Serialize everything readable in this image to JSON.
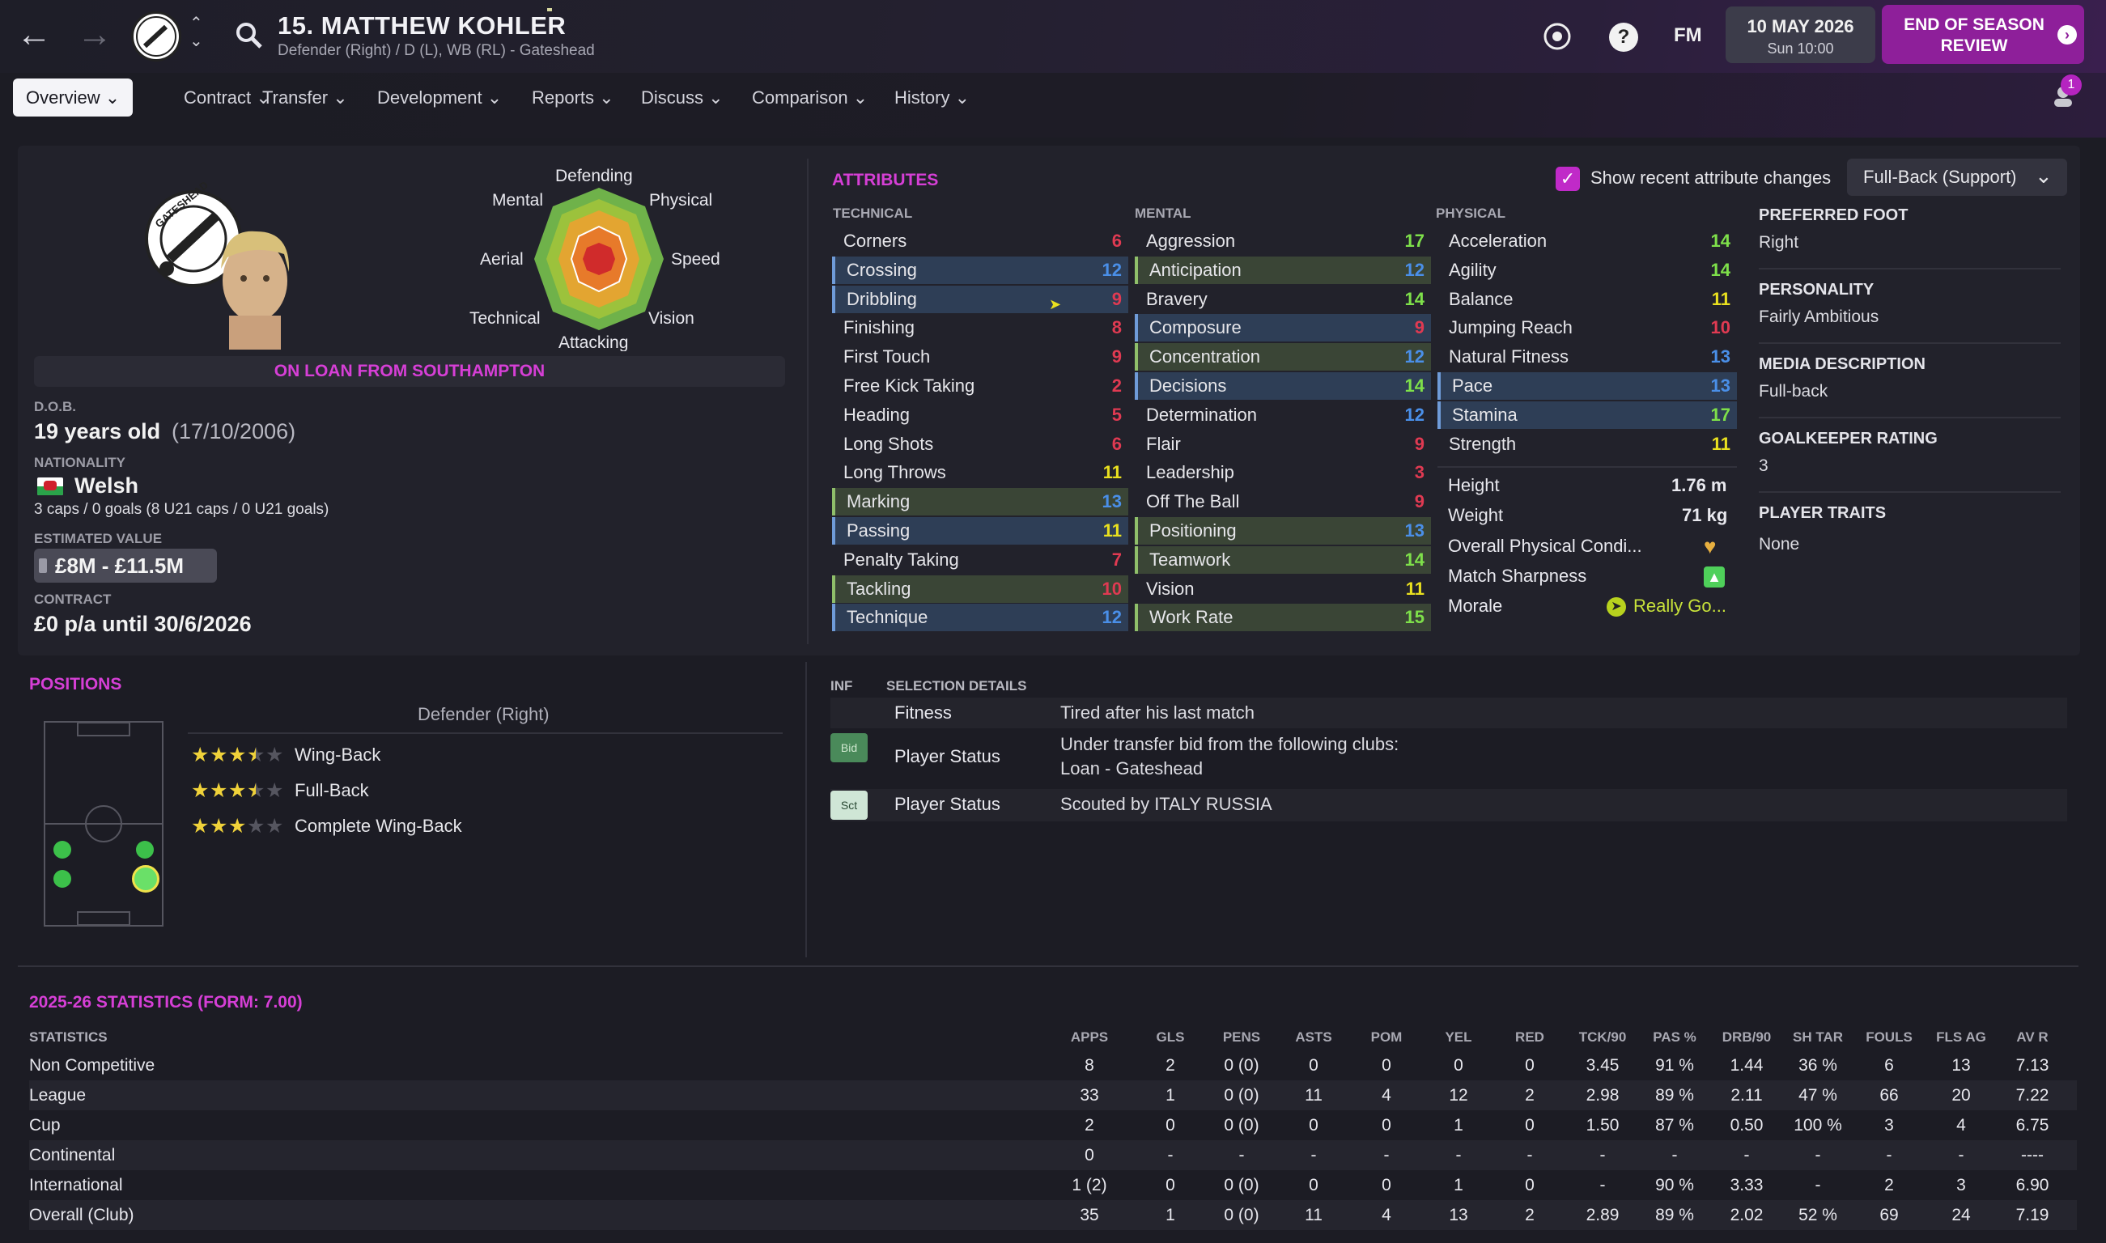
{
  "header": {
    "title": "15. MATTHEW KOHLER",
    "subtitle": "Defender (Right) / D (L), WB (RL) - Gateshead",
    "date": "10 MAY 2026",
    "time": "Sun 10:00",
    "fm_label": "FM",
    "help_label": "?",
    "eos_button": "END OF SEASON REVIEW",
    "notification_count": "1"
  },
  "tabs": [
    "Overview",
    "Contract",
    "Transfer",
    "Development",
    "Reports",
    "Discuss",
    "Comparison",
    "History"
  ],
  "profile": {
    "club_badge_text": "GATESHEAD",
    "radar_labels": {
      "defending": "Defending",
      "physical": "Physical",
      "speed": "Speed",
      "vision": "Vision",
      "attacking": "Attacking",
      "technical": "Technical",
      "aerial": "Aerial",
      "mental": "Mental"
    },
    "loan_banner": "ON LOAN FROM SOUTHAMPTON",
    "dob_label": "D.O.B.",
    "age": "19 years old",
    "dob": "(17/10/2006)",
    "nationality_label": "NATIONALITY",
    "nationality": "Welsh",
    "caps": "3 caps / 0 goals (8 U21 caps / 0 U21 goals)",
    "value_label": "ESTIMATED VALUE",
    "value": "£8M - £11.5M",
    "contract_label": "CONTRACT",
    "contract": "£0 p/a until 30/6/2026"
  },
  "attributes": {
    "title": "ATTRIBUTES",
    "show_changes_label": "Show recent attribute changes",
    "role_select": "Full-Back (Support)",
    "technical_label": "TECHNICAL",
    "mental_label": "MENTAL",
    "physical_label": "PHYSICAL",
    "technical": [
      {
        "name": "Corners",
        "value": "6",
        "hl": "",
        "color": "red"
      },
      {
        "name": "Crossing",
        "value": "12",
        "hl": "blue",
        "color": "blue"
      },
      {
        "name": "Dribbling",
        "value": "9",
        "hl": "blue",
        "color": "red"
      },
      {
        "name": "Finishing",
        "value": "8",
        "hl": "",
        "color": "red"
      },
      {
        "name": "First Touch",
        "value": "9",
        "hl": "",
        "color": "red"
      },
      {
        "name": "Free Kick Taking",
        "value": "2",
        "hl": "",
        "color": "red"
      },
      {
        "name": "Heading",
        "value": "5",
        "hl": "",
        "color": "red"
      },
      {
        "name": "Long Shots",
        "value": "6",
        "hl": "",
        "color": "red"
      },
      {
        "name": "Long Throws",
        "value": "11",
        "hl": "",
        "color": "yellow"
      },
      {
        "name": "Marking",
        "value": "13",
        "hl": "green",
        "color": "blue"
      },
      {
        "name": "Passing",
        "value": "11",
        "hl": "blue",
        "color": "yellow"
      },
      {
        "name": "Penalty Taking",
        "value": "7",
        "hl": "",
        "color": "red"
      },
      {
        "name": "Tackling",
        "value": "10",
        "hl": "green",
        "color": "red"
      },
      {
        "name": "Technique",
        "value": "12",
        "hl": "blue",
        "color": "blue"
      }
    ],
    "mental": [
      {
        "name": "Aggression",
        "value": "17",
        "hl": "",
        "color": "green"
      },
      {
        "name": "Anticipation",
        "value": "12",
        "hl": "green",
        "color": "blue"
      },
      {
        "name": "Bravery",
        "value": "14",
        "hl": "",
        "color": "green"
      },
      {
        "name": "Composure",
        "value": "9",
        "hl": "blue",
        "color": "red"
      },
      {
        "name": "Concentration",
        "value": "12",
        "hl": "green",
        "color": "blue"
      },
      {
        "name": "Decisions",
        "value": "14",
        "hl": "blue",
        "color": "green"
      },
      {
        "name": "Determination",
        "value": "12",
        "hl": "",
        "color": "blue"
      },
      {
        "name": "Flair",
        "value": "9",
        "hl": "",
        "color": "red"
      },
      {
        "name": "Leadership",
        "value": "3",
        "hl": "",
        "color": "red"
      },
      {
        "name": "Off The Ball",
        "value": "9",
        "hl": "",
        "color": "red"
      },
      {
        "name": "Positioning",
        "value": "13",
        "hl": "green",
        "color": "blue"
      },
      {
        "name": "Teamwork",
        "value": "14",
        "hl": "green",
        "color": "green"
      },
      {
        "name": "Vision",
        "value": "11",
        "hl": "",
        "color": "yellow"
      },
      {
        "name": "Work Rate",
        "value": "15",
        "hl": "green",
        "color": "green"
      }
    ],
    "physical": [
      {
        "name": "Acceleration",
        "value": "14",
        "hl": "",
        "color": "green"
      },
      {
        "name": "Agility",
        "value": "14",
        "hl": "",
        "color": "green"
      },
      {
        "name": "Balance",
        "value": "11",
        "hl": "",
        "color": "yellow"
      },
      {
        "name": "Jumping Reach",
        "value": "10",
        "hl": "",
        "color": "red"
      },
      {
        "name": "Natural Fitness",
        "value": "13",
        "hl": "",
        "color": "blue"
      },
      {
        "name": "Pace",
        "value": "13",
        "hl": "blue",
        "color": "blue"
      },
      {
        "name": "Stamina",
        "value": "17",
        "hl": "blue",
        "color": "green"
      },
      {
        "name": "Strength",
        "value": "11",
        "hl": "",
        "color": "yellow"
      }
    ],
    "height_label": "Height",
    "height": "1.76 m",
    "weight_label": "Weight",
    "weight": "71 kg",
    "condition_label": "Overall Physical Condi...",
    "sharpness_label": "Match Sharpness",
    "morale_label": "Morale",
    "morale": "Really Go..."
  },
  "info": {
    "foot_label": "PREFERRED FOOT",
    "foot": "Right",
    "personality_label": "PERSONALITY",
    "personality": "Fairly Ambitious",
    "media_label": "MEDIA DESCRIPTION",
    "media": "Full-back",
    "gk_label": "GOALKEEPER RATING",
    "gk": "3",
    "traits_label": "PLAYER TRAITS",
    "traits": "None"
  },
  "positions": {
    "title": "POSITIONS",
    "main": "Defender (Right)",
    "roles": [
      {
        "name": "Wing-Back",
        "stars": 3.5
      },
      {
        "name": "Full-Back",
        "stars": 3.5
      },
      {
        "name": "Complete Wing-Back",
        "stars": 3
      }
    ]
  },
  "selection": {
    "inf_label": "INF",
    "details_label": "SELECTION DETAILS",
    "rows": [
      {
        "badge": "",
        "label": "Fitness",
        "detail": "Tired after his last match",
        "detail2": ""
      },
      {
        "badge": "Bid",
        "label": "Player Status",
        "detail": "Under transfer bid from the following clubs:",
        "detail2": "Loan - Gateshead"
      },
      {
        "badge": "Sct",
        "label": "Player Status",
        "detail": "Scouted by ITALY RUSSIA",
        "detail2": ""
      }
    ]
  },
  "stats": {
    "title": "2025-26 STATISTICS (FORM: 7.00)",
    "label": "STATISTICS",
    "headers": [
      "APPS",
      "GLS",
      "PENS",
      "ASTS",
      "POM",
      "YEL",
      "RED",
      "TCK/90",
      "PAS %",
      "DRB/90",
      "SH TAR",
      "FOULS",
      "FLS AG",
      "AV R"
    ],
    "rows": [
      {
        "name": "Non Competitive",
        "cells": [
          "8",
          "2",
          "0 (0)",
          "0",
          "0",
          "0",
          "0",
          "3.45",
          "91 %",
          "1.44",
          "36 %",
          "6",
          "13",
          "7.13"
        ]
      },
      {
        "name": "League",
        "cells": [
          "33",
          "1",
          "0 (0)",
          "11",
          "4",
          "12",
          "2",
          "2.98",
          "89 %",
          "2.11",
          "47 %",
          "66",
          "20",
          "7.22"
        ]
      },
      {
        "name": "Cup",
        "cells": [
          "2",
          "0",
          "0 (0)",
          "0",
          "0",
          "1",
          "0",
          "1.50",
          "87 %",
          "0.50",
          "100 %",
          "3",
          "4",
          "6.75"
        ]
      },
      {
        "name": "Continental",
        "cells": [
          "0",
          "-",
          "-",
          "-",
          "-",
          "-",
          "-",
          "-",
          "-",
          "-",
          "-",
          "-",
          "-",
          "----"
        ]
      },
      {
        "name": "International",
        "cells": [
          "1 (2)",
          "0",
          "0 (0)",
          "0",
          "0",
          "1",
          "0",
          "-",
          "90 %",
          "3.33",
          "-",
          "2",
          "3",
          "6.90"
        ]
      },
      {
        "name": "Overall (Club)",
        "cells": [
          "35",
          "1",
          "0 (0)",
          "11",
          "4",
          "13",
          "2",
          "2.89",
          "89 %",
          "2.02",
          "52 %",
          "69",
          "24",
          "7.19"
        ]
      }
    ]
  },
  "colors": {
    "accent": "#d63fd6",
    "eos": "#8e1f9a",
    "red": "#e03a52",
    "yellow": "#e9e01f",
    "green": "#7ee04a",
    "blue": "#4a8fe8"
  }
}
